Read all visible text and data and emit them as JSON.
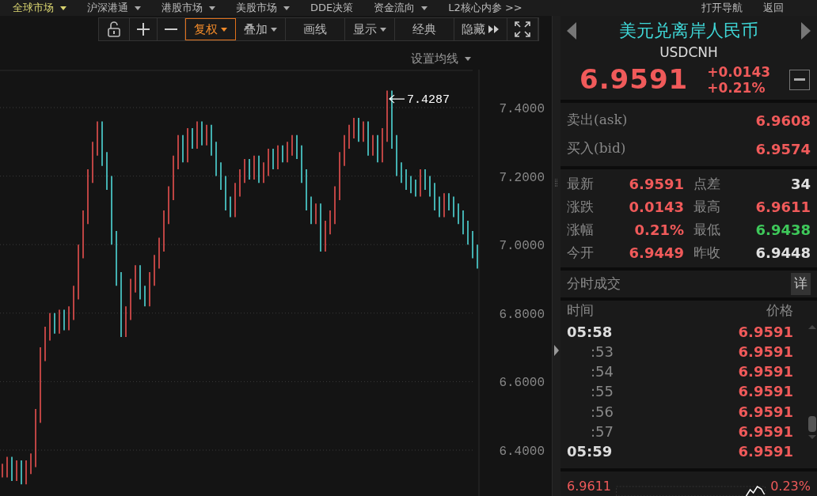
{
  "menu": [
    {
      "label": "全球市场",
      "selected": true,
      "dropdown": true
    },
    {
      "label": "沪深港通",
      "selected": false,
      "dropdown": true
    },
    {
      "label": "港股市场",
      "selected": false,
      "dropdown": true
    },
    {
      "label": "美股市场",
      "selected": false,
      "dropdown": true
    },
    {
      "label": "DDE决策",
      "selected": false,
      "dropdown": false
    },
    {
      "label": "资金流向",
      "selected": false,
      "dropdown": true
    },
    {
      "label": "L2核心内参 >>",
      "selected": false,
      "dropdown": false
    }
  ],
  "menu_right": [
    "打开导航",
    "返回"
  ],
  "toolbar": [
    {
      "kind": "lock"
    },
    {
      "kind": "plus"
    },
    {
      "kind": "minus"
    },
    {
      "kind": "text",
      "label": "复权",
      "dropdown": true,
      "selected": true
    },
    {
      "kind": "text",
      "label": "叠加",
      "dropdown": true,
      "selected": false
    },
    {
      "kind": "text",
      "label": "画线",
      "dropdown": false,
      "selected": false
    },
    {
      "kind": "text",
      "label": "显示",
      "dropdown": true,
      "selected": false
    },
    {
      "kind": "text",
      "label": "经典",
      "dropdown": false,
      "selected": false
    },
    {
      "kind": "more",
      "label": "隐藏"
    },
    {
      "kind": "fullscreen"
    }
  ],
  "chart": {
    "ma_setting": "设置均线",
    "y_axis_labels": [
      "7.4000",
      "7.2000",
      "7.0000",
      "6.8000",
      "6.6000",
      "6.4000"
    ],
    "peak_label": "7.4287"
  },
  "quote": {
    "title": "美元兑离岸人民币",
    "symbol": "USDCNH",
    "price": "6.9591",
    "change": "+0.0143",
    "change_pct": "+0.21%"
  },
  "book": [
    {
      "label": "卖出(ask)",
      "value": "6.9608",
      "color": "#f05a5a"
    },
    {
      "label": "买入(bid)",
      "value": "6.9574",
      "color": "#f05a5a"
    }
  ],
  "stats": [
    {
      "label": "最新",
      "value": "6.9591",
      "color": "#f05a5a"
    },
    {
      "label": "点差",
      "value": "34",
      "color": "#e0e0e0"
    },
    {
      "label": "涨跌",
      "value": "0.0143",
      "color": "#f05a5a"
    },
    {
      "label": "最高",
      "value": "6.9611",
      "color": "#f05a5a"
    },
    {
      "label": "涨幅",
      "value": "0.21%",
      "color": "#f05a5a"
    },
    {
      "label": "最低",
      "value": "6.9438",
      "color": "#3ec85a"
    },
    {
      "label": "今开",
      "value": "6.9449",
      "color": "#f05a5a"
    },
    {
      "label": "昨收",
      "value": "6.9448",
      "color": "#e0e0e0"
    }
  ],
  "trades": {
    "title": "分时成交",
    "detail_button": "详",
    "columns": [
      "时间",
      "价格"
    ],
    "rows": [
      {
        "kind": "minute",
        "time": "05:58",
        "price": "6.9591"
      },
      {
        "kind": "second",
        "time": ":53",
        "price": "6.9591"
      },
      {
        "kind": "second",
        "time": ":54",
        "price": "6.9591"
      },
      {
        "kind": "second",
        "time": ":55",
        "price": "6.9591"
      },
      {
        "kind": "second",
        "time": ":56",
        "price": "6.9591"
      },
      {
        "kind": "second",
        "time": ":57",
        "price": "6.9591"
      },
      {
        "kind": "minute",
        "time": "05:59",
        "price": "6.9591"
      }
    ]
  },
  "mini_chart": {
    "high": "6.9611",
    "high_pct": "0.23%"
  }
}
